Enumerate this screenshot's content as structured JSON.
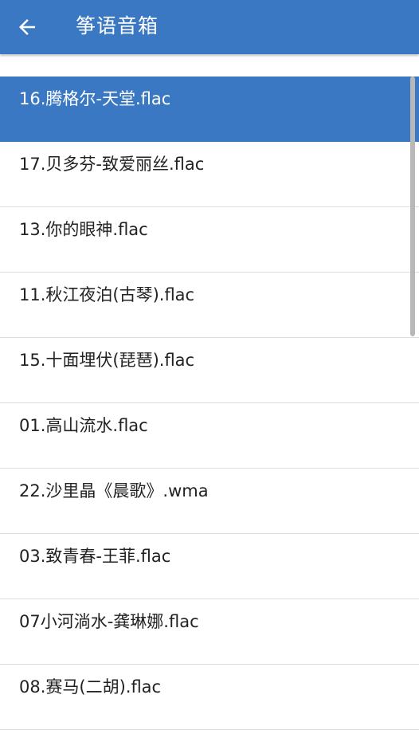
{
  "header": {
    "back_icon": "arrow-left-icon",
    "title": "筝语音箱",
    "background_color": "#3a78c4"
  },
  "playlist": {
    "selected_index": 0,
    "selected_color": "#3a78c4",
    "items": [
      {
        "label": "16.腾格尔-天堂.flac"
      },
      {
        "label": "17.贝多芬-致爱丽丝.flac"
      },
      {
        "label": "13.你的眼神.flac"
      },
      {
        "label": "11.秋江夜泊(古琴).flac"
      },
      {
        "label": "15.十面埋伏(琵琶).flac"
      },
      {
        "label": "01.高山流水.flac"
      },
      {
        "label": "22.沙里晶《晨歌》.wma"
      },
      {
        "label": "03.致青春-王菲.flac"
      },
      {
        "label": "07小河淌水-龚琳娜.flac"
      },
      {
        "label": "08.赛马(二胡).flac"
      }
    ]
  }
}
